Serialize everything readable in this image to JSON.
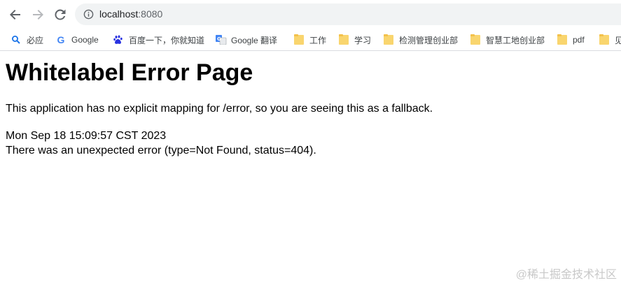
{
  "browser": {
    "url_host": "localhost",
    "url_port": ":8080",
    "bookmarks": [
      {
        "label": "必应",
        "icon": "search-icon"
      },
      {
        "label": "Google",
        "icon": "google-icon"
      },
      {
        "label": "百度一下，你就知道",
        "icon": "baidu-paw-icon"
      },
      {
        "label": "Google 翻译",
        "icon": "google-translate-icon"
      },
      {
        "label": "工作",
        "icon": "folder-icon"
      },
      {
        "label": "学习",
        "icon": "folder-icon"
      },
      {
        "label": "检测管理创业部",
        "icon": "folder-icon"
      },
      {
        "label": "智慧工地创业部",
        "icon": "folder-icon"
      },
      {
        "label": "pdf",
        "icon": "folder-icon"
      },
      {
        "label": "见",
        "icon": "folder-icon"
      }
    ]
  },
  "page": {
    "title": "Whitelabel Error Page",
    "message": "This application has no explicit mapping for /error, so you are seeing this as a fallback.",
    "timestamp": "Mon Sep 18 15:09:57 CST 2023",
    "error_detail": "There was an unexpected error (type=Not Found, status=404)."
  },
  "watermark": "@稀土掘金技术社区",
  "colors": {
    "omnibox_bg": "#f1f3f4",
    "folder": "#f9d56e",
    "watermark": "#c8c8c8"
  }
}
